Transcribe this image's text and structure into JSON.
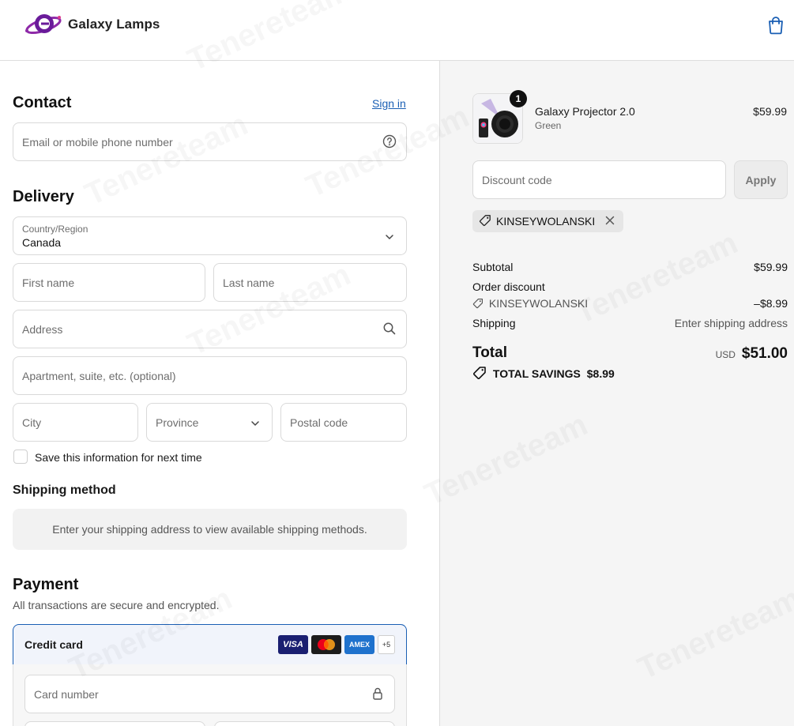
{
  "brand": {
    "name": "Galaxy Lamps"
  },
  "contact": {
    "title": "Contact",
    "sign_in": "Sign in",
    "email_placeholder": "Email or mobile phone number"
  },
  "delivery": {
    "title": "Delivery",
    "country_label": "Country/Region",
    "country_value": "Canada",
    "first_name": "First name",
    "last_name": "Last name",
    "address": "Address",
    "apartment": "Apartment, suite, etc. (optional)",
    "city": "City",
    "province": "Province",
    "postal": "Postal code",
    "save_info": "Save this information for next time"
  },
  "shipping_method": {
    "title": "Shipping method",
    "message": "Enter your shipping address to view available shipping methods."
  },
  "payment": {
    "title": "Payment",
    "subtitle": "All transactions are secure and encrypted.",
    "method_label": "Credit card",
    "cards": [
      "VISA",
      "",
      "AMEX",
      "+5"
    ],
    "card_number": "Card number"
  },
  "order": {
    "item": {
      "name": "Galaxy Projector 2.0",
      "variant": "Green",
      "price": "$59.99",
      "quantity": "1"
    },
    "discount_placeholder": "Discount code",
    "apply_label": "Apply",
    "applied_code": "KINSEYWOLANSKI",
    "subtotal_label": "Subtotal",
    "subtotal_value": "$59.99",
    "order_discount_label": "Order discount",
    "discount_code": "KINSEYWOLANSKI",
    "discount_value": "–$8.99",
    "shipping_label": "Shipping",
    "shipping_value": "Enter shipping address",
    "total_label": "Total",
    "currency": "USD",
    "total_value": "$51.00",
    "savings_label": "TOTAL SAVINGS",
    "savings_value": "$8.99"
  },
  "watermark_text": "Tenereteam"
}
